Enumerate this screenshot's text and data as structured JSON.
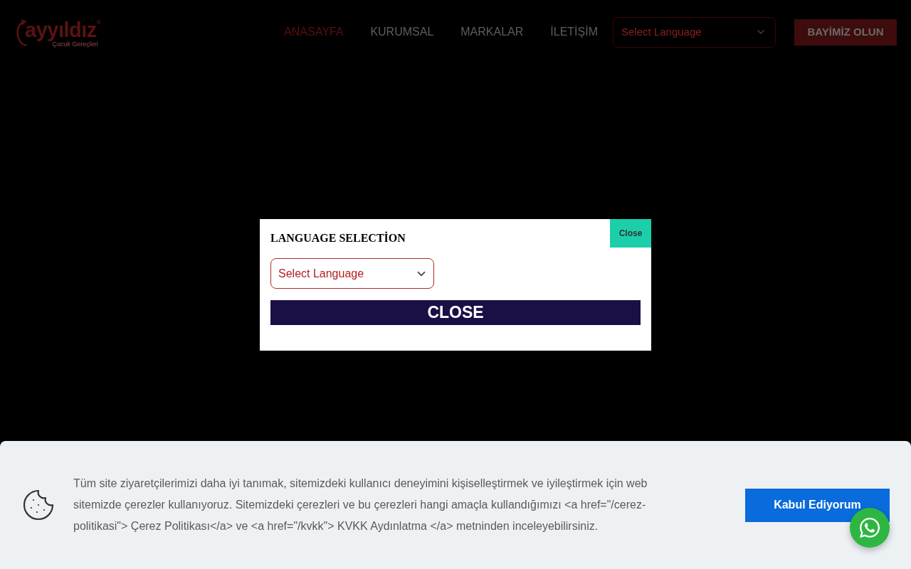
{
  "header": {
    "logo": {
      "name": "ayyıldız",
      "mark": "®",
      "tagline": "Çocuk Gereçleri"
    },
    "nav": [
      {
        "label": "ANASAYFA",
        "selected": true
      },
      {
        "label": "KURUMSAL",
        "selected": false
      },
      {
        "label": "MARKALAR",
        "selected": false
      },
      {
        "label": "İLETİŞİM",
        "selected": false
      }
    ],
    "language_select": {
      "value": "Select Language"
    },
    "cta_button": "BAYİMİZ OLUN"
  },
  "modal": {
    "title": "LANGUAGE SELECTİON",
    "close_tab": "Close",
    "language_select": {
      "value": "Select Language"
    },
    "close_button": "CLOSE"
  },
  "cookie_banner": {
    "text": "Tüm site ziyaretçilerimizi daha iyi tanımak, sitemizdeki kullanıcı deneyimini kişiselleştirmek ve iyileştirmek için web sitemizde çerezler kullanıyoruz. Sitemizdeki çerezleri ve bu çerezleri hangi amaçla kullandığımızı <a href=\"/cerez-politikasi\"> Çerez Politikası</a> ve <a href=\"/kvkk\"> KVKK Aydınlatma </a> metninden inceleyebilirsiniz.",
    "accept_button": "Kabul Ediyorum"
  }
}
